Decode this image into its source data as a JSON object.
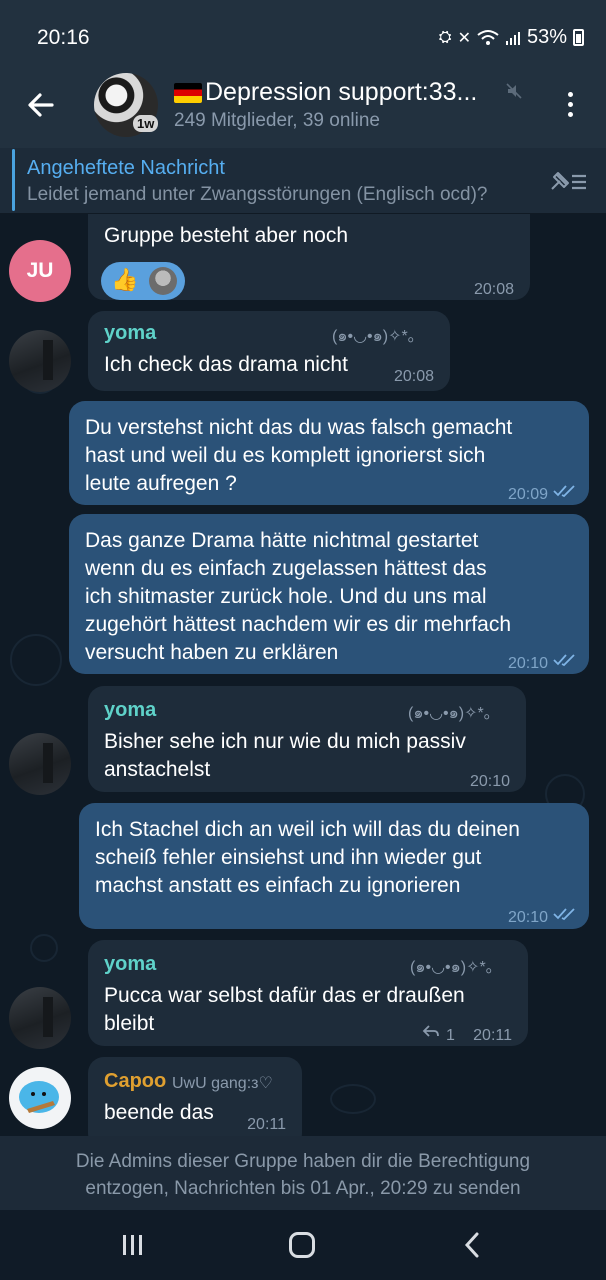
{
  "status_bar": {
    "time": "20:16",
    "battery": "53%"
  },
  "header": {
    "title": "Depression support:33...",
    "subtitle": "249 Mitglieder, 39 online",
    "avatar_badge": "1w"
  },
  "pinned": {
    "title": "Angeheftete Nachricht",
    "text": "Leidet jemand unter Zwangsstörungen (Englisch ocd)?"
  },
  "messages": [
    {
      "text": "Gruppe besteht aber noch",
      "time": "20:08",
      "avatar_initials": "JU"
    },
    {
      "sender": "yoma",
      "tag": "(๑•◡•๑)✧*｡",
      "text": "Ich check das drama nicht",
      "time": "20:08"
    },
    {
      "text_lines": [
        "Du verstehst nicht das du was falsch gemacht",
        "hast und weil du es komplett ignorierst sich",
        "leute aufregen ?"
      ],
      "time": "20:09"
    },
    {
      "text_lines": [
        "Das ganze Drama hätte nichtmal gestartet",
        "wenn du es einfach zugelassen hättest das",
        "ich shitmaster zurück hole. Und du uns mal",
        "zugehört hättest nachdem wir es dir mehrfach",
        "versucht haben zu erklären"
      ],
      "time": "20:10"
    },
    {
      "sender": "yoma",
      "tag": "(๑•◡•๑)✧*｡",
      "text_lines": [
        "Bisher sehe ich nur wie du mich passiv",
        "anstachelst"
      ],
      "time": "20:10"
    },
    {
      "text_lines": [
        "Ich Stachel dich an weil ich will das du deinen",
        "scheiß fehler einsiehst und ihn wieder gut",
        "machst anstatt es einfach zu ignorieren"
      ],
      "time": "20:10"
    },
    {
      "sender": "yoma",
      "tag": "(๑•◡•๑)✧*｡",
      "text_lines": [
        "Pucca war selbst dafür das er draußen",
        "bleibt"
      ],
      "time": "20:11",
      "replies": "1"
    },
    {
      "sender": "Capoo",
      "tag": "UwU gang:з♡",
      "text": "beende das",
      "time": "20:11"
    }
  ],
  "restriction_notice": {
    "line1": "Die Admins dieser Gruppe haben dir die Berechtigung",
    "line2": "entzogen, Nachrichten bis 01 Apr., 20:29 zu senden"
  },
  "colors": {
    "accent": "#56aef0",
    "outgoing_bubble": "#2b5278",
    "incoming_bubble": "#1e2c3a",
    "sender_yoma": "#5fd2c9",
    "sender_capoo": "#e0a030"
  }
}
